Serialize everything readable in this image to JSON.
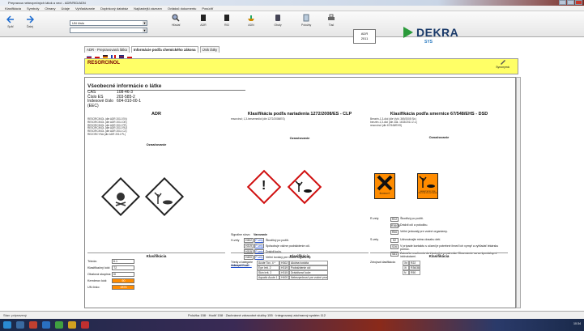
{
  "window": {
    "title": "Prepravca nebezpečných látok a vecí - ADR/RID/ADN"
  },
  "menu": [
    "Klasifikácia",
    "Symboly",
    "Obrany",
    "Údaje",
    "Vyhľadávanie",
    "Doplnkový databáz",
    "Najčastejší záznam",
    "Ovládač dokumentu",
    "Posúdiť"
  ],
  "toolbar": {
    "nav": [
      {
        "label": "Späť"
      },
      {
        "label": "Ďalej"
      }
    ],
    "un_combo": "UN číslo",
    "buttons": [
      {
        "label": "Hľadať"
      },
      {
        "label": "ADR"
      },
      {
        "label": "RID"
      },
      {
        "label": "ADN"
      },
      {
        "label": "Obaly"
      },
      {
        "label": "Položky"
      },
      {
        "label": "Tlač"
      }
    ],
    "adr_box": {
      "line1": "ADR",
      "line2": "2011"
    },
    "logo": {
      "name": "DEKRA",
      "sub": "SYS"
    }
  },
  "tabs": [
    {
      "label": "ADR - Prepravovaná látka"
    },
    {
      "label": "Informácie podľa chemického zákona"
    },
    {
      "label": "Únik látky"
    }
  ],
  "substance": {
    "name": "RESORCINOL",
    "synonyms_label": "Synonymá"
  },
  "general": {
    "heading": "Všeobecné informácie o látke",
    "rows": [
      {
        "k": "CAS",
        "v": "108-46-3"
      },
      {
        "k": "Číslo ES",
        "v": "203-585-2"
      },
      {
        "k": "Indexové číslo (EEC)",
        "v": "604-010-00-1"
      }
    ]
  },
  "adr": {
    "title": "ADR",
    "lines": [
      "RESORCINOL (dle ADR 2011 EN)",
      "RESORCINOL (dle ADR 2011 DE)",
      "RESORCINOL (dle ADR 2011 FR)",
      "RESORCINOL (dle ADR 2011 RU)",
      "RESORCINOL (dle ADR 2011 CZ)",
      "REZORCYNA (dle ADR 2011 PL)"
    ],
    "label_heading": "Označovanie",
    "klas": {
      "title": "Klasifikácia",
      "rows": [
        {
          "k": "Trieda:",
          "v": "6.1"
        },
        {
          "k": "Klasifikačný kód:",
          "v": "T2"
        },
        {
          "k": "Obalová skupina:",
          "v": "III"
        },
        {
          "k": "Kemlerov kód:",
          "v": "60",
          "hl": true
        },
        {
          "k": "UN číslo:",
          "v": "2876",
          "hl": true
        }
      ]
    }
  },
  "clp": {
    "title": "Klasifikácia podľa nariadenia 1272/2008/ES - CLP",
    "sub": "resorcinol; 1,3-benzenediol (dle 1272/2008/ES)",
    "label_heading": "Označovanie",
    "signal_k": "Signálne slovo:",
    "signal_v": "Varovanie",
    "hlabel": "H-vety",
    "h": [
      {
        "code": "H302",
        "lnk": "P-vety",
        "txt": "Škodlivý po požití."
      },
      {
        "code": "H319",
        "lnk": "P-vety",
        "txt": "Spôsobuje vážne podráždenie očí."
      },
      {
        "code": "H315",
        "lnk": "P-vety",
        "txt": "Dráždi kožu."
      },
      {
        "code": "H400",
        "lnk": "P-vety",
        "txt": "Veľmi toxický pre vodné organizmy."
      }
    ],
    "link": "Zobraziť P-vet...",
    "klas": {
      "title": "Klasifikácia",
      "left": "Triedy a kategórie nebezpečnosti",
      "rows": [
        {
          "a": "Acute Tox. 4 *",
          "b": "H302",
          "c": "Akútna toxicita"
        },
        {
          "a": "Eye Irrit. 2",
          "b": "H319",
          "c": "Podráždenie očí"
        },
        {
          "a": "Skin Irrit. 2",
          "b": "H315",
          "c": "Dráždivosť kože"
        },
        {
          "a": "Aquatic Acute 1",
          "b": "H400",
          "c": "Nebezpečnosť pre vodné prostredie"
        }
      ]
    }
  },
  "dsd": {
    "title": "Klasifikácia podľa smernice 67/548/EHS - DSD",
    "sub_lines": [
      "Benzén-1,3-diol (dle Vyhl. 369/2005 Sb.)",
      "benzén-1,3-diol (dle Zák. 1633/2011 Z.z.)",
      "resorcinol (dle 67/548/EHS)"
    ],
    "label_heading": "Označovanie",
    "sym1": "ŠKODLIVÝ",
    "sym2": "NEBEZPEČNÝ PRE ŽIVOTNÉ PROSTREDIE",
    "rlabel": "R-vety",
    "slabel": "S-vety",
    "r": [
      {
        "code": "R22",
        "txt": "Škodlivý po požití."
      },
      {
        "code": "R36/38",
        "txt": "Dráždi oči a pokožku."
      },
      {
        "code": "R50",
        "txt": "Veľmi jedovatý pre vodné organizmy."
      }
    ],
    "s": [
      {
        "code": "S2",
        "txt": "Uchovávajte mimo dosahu detí."
      },
      {
        "code": "S26",
        "txt": "V prípade kontaktu s očami je potrebné ihneď ich vymyť a vyhľadať lekársku pomoc."
      },
      {
        "code": "S61",
        "txt": "Zabráňte uvoľneniu do životného prostredia. Oboznámte sa so špeciálnymi inštrukciami."
      }
    ],
    "klas": {
      "title": "Klasifikácia",
      "left": "Zdrojová klasifikácia:",
      "rows": [
        {
          "a": "Xn",
          "b": "R22"
        },
        {
          "a": "Xi",
          "b": "R36/38"
        },
        {
          "a": "N",
          "b": "R50"
        }
      ]
    }
  },
  "status": {
    "left": "Stav: pripravený",
    "center": "Položka 158 · Hodiť 158 · Zachránné zdravotné služby 155 · Integrovaný záchranný systém 112"
  },
  "clock": "10:34"
}
